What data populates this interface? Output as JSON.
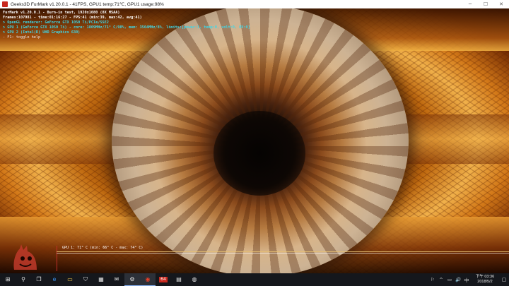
{
  "window": {
    "title": "Geeks3D FurMark v1.20.0.1 - 41FPS, GPU1 temp:71℃, GPU1 usage:98%",
    "minimize_glyph": "─",
    "maximize_glyph": "☐",
    "close_glyph": "✕"
  },
  "osd": {
    "lines": [
      "FurMark v1.20.0.1 - Burn-in test, 1920x1080 (8X MSAA)",
      "Frames:107981 - time:01:16:27 - FPS:41 (min:39, max:42, avg:41)",
      "> OpenGL renderer: GeForce GTX 1050 Ti/PCIe/SSE2",
      "> GPU 1 (GeForce GTX 1050 Ti) - core: 1809MHz/71° C/98%, mem: 3504MHz/8%, limits:[power:1, temp:0, volt:0, OV:0]",
      "> GPU 2 (Intel(R) UHD Graphics 630)",
      "- F1: toggle help"
    ]
  },
  "graph": {
    "label": "GPU 1: 71° C (min: 66° C - max: 74° C)",
    "temp_current": 71,
    "temp_min": 66,
    "temp_max": 74,
    "line_color": "#e8c070"
  },
  "taskbar": {
    "items": [
      {
        "name": "start-icon",
        "glyph": "⊞",
        "active": false
      },
      {
        "name": "search-icon",
        "glyph": "⚲",
        "active": false
      },
      {
        "name": "task-view-icon",
        "glyph": "❒",
        "active": false
      },
      {
        "name": "edge-icon",
        "glyph": "e",
        "active": false
      },
      {
        "name": "file-explorer-icon",
        "glyph": "▭",
        "active": false
      },
      {
        "name": "store-icon",
        "glyph": "⛉",
        "active": false
      },
      {
        "name": "gift-icon",
        "glyph": "▦",
        "active": false
      },
      {
        "name": "mail-icon",
        "glyph": "✉",
        "active": false
      },
      {
        "name": "settings-icon",
        "glyph": "⚙",
        "active": true
      },
      {
        "name": "furmark-icon",
        "glyph": "◉",
        "active": true
      },
      {
        "name": "app-64-icon",
        "glyph": "64",
        "active": false
      },
      {
        "name": "calendar-icon",
        "glyph": "▤",
        "active": false
      },
      {
        "name": "app-icon",
        "glyph": "◍",
        "active": false
      }
    ],
    "tray": {
      "icons": [
        "⚐",
        "^",
        "▭",
        "🔊",
        "中"
      ],
      "time": "下午 03:36",
      "date": "2018/5/2",
      "notification_glyph": "▢"
    }
  }
}
